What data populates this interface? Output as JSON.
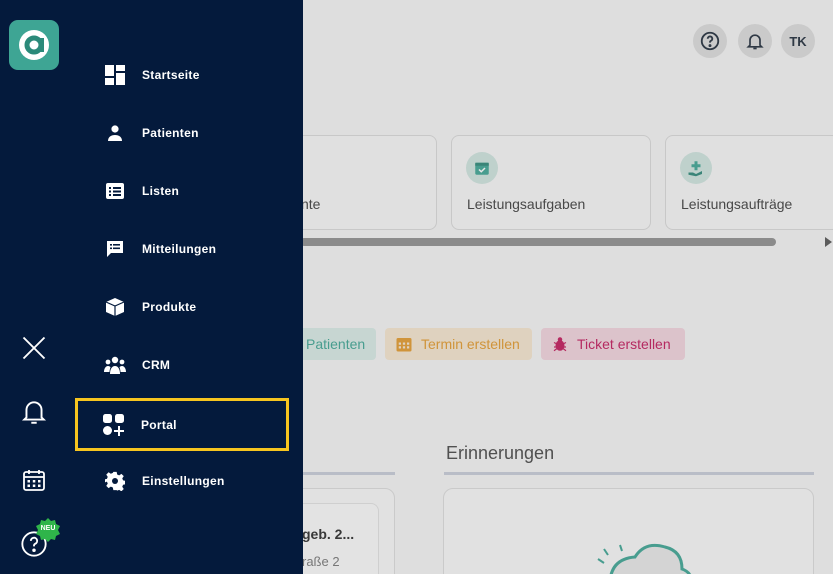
{
  "topbar": {
    "help_icon": "help-circle-icon",
    "bell_icon": "bell-icon",
    "avatar_initials": "TK"
  },
  "cards": [
    {
      "label": "nte",
      "icon": "none"
    },
    {
      "label": "Leistungsaufgaben",
      "icon": "calendar-check-icon"
    },
    {
      "label": "Leistungsaufträge",
      "icon": "hand-plus-icon"
    }
  ],
  "quick_actions": [
    {
      "label": "Patienten",
      "color": "#3ea594",
      "bg": "#d8ebe6"
    },
    {
      "label": "Termin erstellen",
      "color": "#e39a2d",
      "bg": "#f6e6cf"
    },
    {
      "label": "Ticket erstellen",
      "color": "#c2185b",
      "bg": "#f2d3dd"
    }
  ],
  "sections": {
    "reminders_title": "Erinnerungen",
    "left_item_title": "geb. 2...",
    "left_item_sub": "raße 2"
  },
  "sidebar": {
    "logo_letter": "a",
    "rail": {
      "close_icon": "close-icon",
      "bell_icon": "bell-icon",
      "calendar_icon": "calendar-icon",
      "help_icon": "help-circle-icon",
      "new_badge": "NEU"
    },
    "menu": [
      {
        "label": "Startseite",
        "icon": "dashboard-icon"
      },
      {
        "label": "Patienten",
        "icon": "person-icon"
      },
      {
        "label": "Listen",
        "icon": "list-icon"
      },
      {
        "label": "Mitteilungen",
        "icon": "message-icon"
      },
      {
        "label": "Produkte",
        "icon": "box-icon"
      },
      {
        "label": "CRM",
        "icon": "people-icon"
      },
      {
        "label": "Portal",
        "icon": "apps-add-icon"
      },
      {
        "label": "Einstellungen",
        "icon": "gear-icon"
      }
    ]
  },
  "colors": {
    "sidebar_bg": "#041a3c",
    "brand": "#3ea594",
    "highlight": "#f7c51f"
  }
}
